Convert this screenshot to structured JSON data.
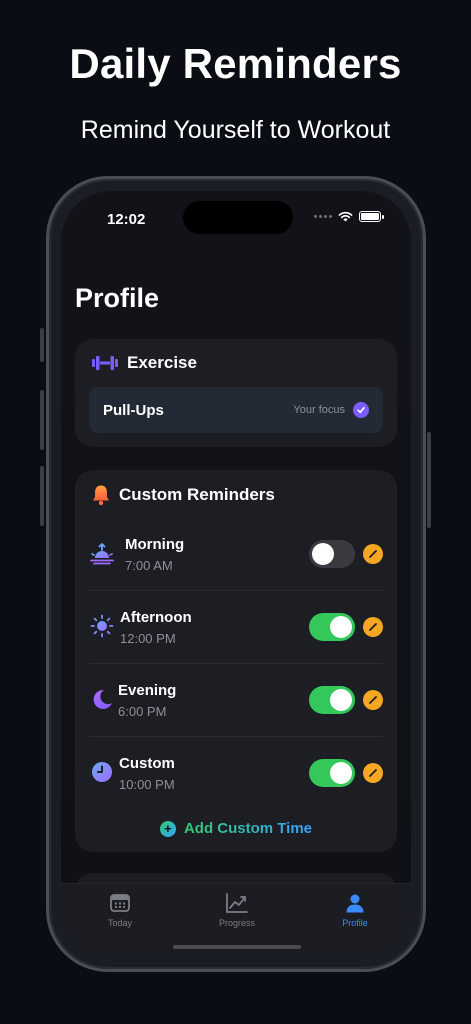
{
  "hero": {
    "title": "Daily Reminders",
    "subtitle": "Remind Yourself to Workout"
  },
  "status_bar": {
    "time": "12:02"
  },
  "page": {
    "title": "Profile"
  },
  "exercise": {
    "header": "Exercise",
    "selected": "Pull-Ups",
    "tag": "Your focus",
    "icon": "dumbbell-icon"
  },
  "reminders": {
    "header": "Custom Reminders",
    "icon": "bell-icon",
    "items": [
      {
        "label": "Morning",
        "time": "7:00 AM",
        "enabled": false,
        "icon": "sunrise-icon"
      },
      {
        "label": "Afternoon",
        "time": "12:00 PM",
        "enabled": true,
        "icon": "sun-icon"
      },
      {
        "label": "Evening",
        "time": "6:00 PM",
        "enabled": true,
        "icon": "moon-icon"
      },
      {
        "label": "Custom",
        "time": "10:00 PM",
        "enabled": true,
        "icon": "clock-icon"
      }
    ],
    "add_label": "Add Custom Time"
  },
  "tabs": [
    {
      "label": "Today",
      "icon": "calendar-icon",
      "active": false
    },
    {
      "label": "Progress",
      "icon": "chart-icon",
      "active": false
    },
    {
      "label": "Profile",
      "icon": "person-icon",
      "active": true
    }
  ],
  "colors": {
    "background": "#0b0d14",
    "card": "#1d1e23",
    "toggle_on": "#34c759",
    "edit": "#f5a623",
    "accent_purple": "#7b5cff",
    "tab_active": "#3b8bff"
  }
}
